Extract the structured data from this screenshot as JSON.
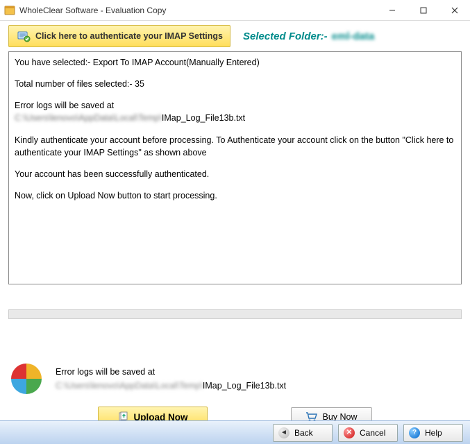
{
  "window": {
    "title": "WholeClear Software - Evaluation Copy"
  },
  "header": {
    "auth_button": "Click here to authenticate your IMAP Settings",
    "selected_folder_label": "Selected Folder:-",
    "selected_folder_value": "eml-data"
  },
  "log": {
    "line1": "You have selected:- Export To IMAP Account(Manually Entered)",
    "line2": "Total number of files selected:- 35",
    "line3": "Error logs will be saved at",
    "line3_path_blurred": "C:\\Users\\lenovo\\AppData\\Local\\Temp\\",
    "line3_path_clear": "IMap_Log_File13b.txt",
    "line4": "Kindly authenticate your account before processing. To Authenticate your account click on the button \"Click here to authenticate your IMAP Settings\" as shown above",
    "line5": "Your account has been successfully authenticated.",
    "line6": "Now, click on Upload Now button to start processing."
  },
  "footer": {
    "error_label": "Error logs will be saved at",
    "path_blurred": "C:\\Users\\lenovo\\AppData\\Local\\Temp\\",
    "path_clear": "IMap_Log_File13b.txt"
  },
  "actions": {
    "upload": "Upload Now",
    "buy": "Buy Now"
  },
  "nav": {
    "back": "Back",
    "cancel": "Cancel",
    "help": "Help"
  }
}
